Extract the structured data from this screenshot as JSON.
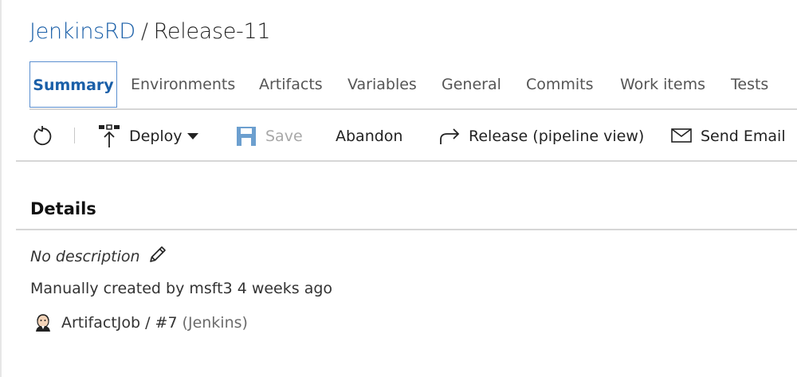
{
  "header": {
    "project": "JenkinsRD",
    "separator": "/",
    "release_name": "Release-11"
  },
  "tabs": [
    {
      "label": "Summary",
      "active": true
    },
    {
      "label": "Environments",
      "active": false
    },
    {
      "label": "Artifacts",
      "active": false
    },
    {
      "label": "Variables",
      "active": false
    },
    {
      "label": "General",
      "active": false
    },
    {
      "label": "Commits",
      "active": false
    },
    {
      "label": "Work items",
      "active": false
    },
    {
      "label": "Tests",
      "active": false
    }
  ],
  "toolbar": {
    "refresh_icon": "refresh-icon",
    "deploy_label": "Deploy",
    "save_label": "Save",
    "abandon_label": "Abandon",
    "release_pipeline_label": "Release (pipeline view)",
    "send_email_label": "Send Email"
  },
  "details": {
    "title": "Details",
    "description": "No description",
    "created_text": "Manually created by msft3 4 weeks ago",
    "artifact_link": "ArtifactJob / #7",
    "artifact_source": "(Jenkins)"
  },
  "colors": {
    "accent": "#1a5fa8",
    "disabled": "#a8a8a8",
    "save_icon": "#6c9fcf",
    "divider": "#d6d6d6"
  }
}
